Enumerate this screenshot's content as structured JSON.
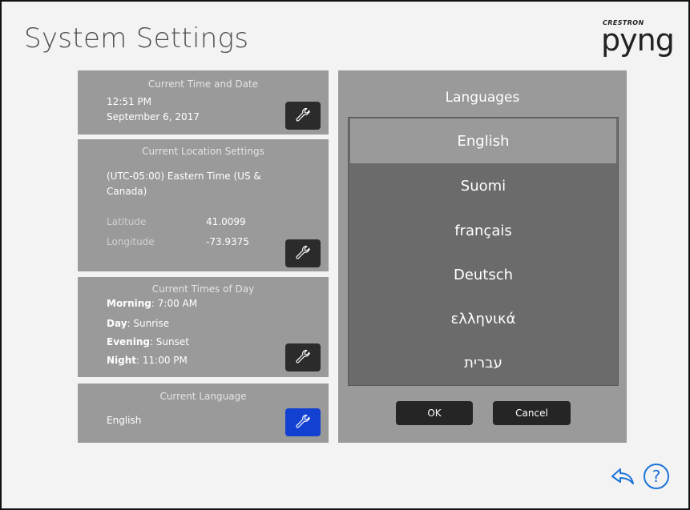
{
  "header": {
    "title": "System Settings",
    "logo_brand": "CRESTRON",
    "logo_mark": "pyng"
  },
  "time_card": {
    "title": "Current Time and Date",
    "time": "12:51 PM",
    "date": "September 6, 2017"
  },
  "location_card": {
    "title": "Current Location Settings",
    "timezone_line1": "(UTC-05:00) Eastern Time (US &",
    "timezone_line2": "Canada)",
    "latitude_label": "Latitude",
    "latitude_value": "41.0099",
    "longitude_label": "Longitude",
    "longitude_value": "-73.9375"
  },
  "times_card": {
    "title": "Current Times of Day",
    "rows": [
      {
        "label": "Morning",
        "value": ": 7:00 AM"
      },
      {
        "label": "Day",
        "value": ": Sunrise"
      },
      {
        "label": "Evening",
        "value": ": Sunset"
      },
      {
        "label": "Night",
        "value": ": 11:00 PM"
      }
    ]
  },
  "language_card": {
    "title": "Current Language",
    "value": "English"
  },
  "languages_panel": {
    "title": "Languages",
    "selected_index": 0,
    "items": [
      "English",
      "Suomi",
      "français",
      "Deutsch",
      "ελληνικά",
      "עברית"
    ],
    "ok_label": "OK",
    "cancel_label": "Cancel"
  },
  "icons": {
    "edit": "wrench-icon",
    "back": "back-arrow-icon",
    "help": "help-icon"
  },
  "colors": {
    "card_bg": "#9a9a9a",
    "list_bg": "#6b6b6b",
    "active_button": "#1240d0",
    "accent_icon": "#1a73d8"
  }
}
